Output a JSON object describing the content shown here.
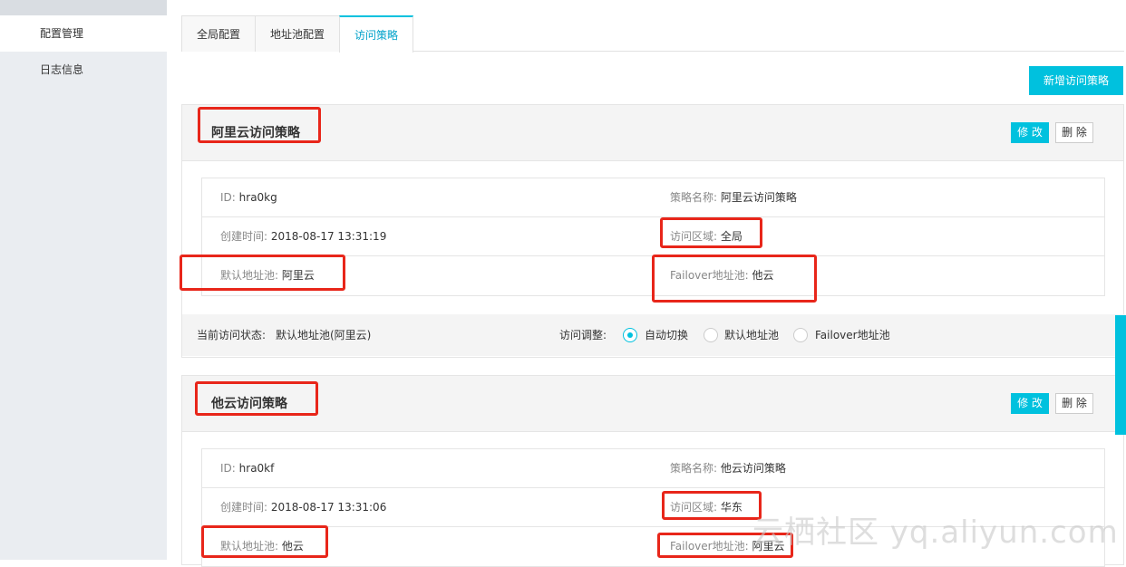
{
  "sidebar": {
    "items": [
      {
        "label": "配置管理"
      },
      {
        "label": "日志信息"
      }
    ]
  },
  "tabs": [
    {
      "label": "全局配置"
    },
    {
      "label": "地址池配置"
    },
    {
      "label": "访问策略"
    }
  ],
  "add_button": "新增访问策略",
  "edit_label": "修 改",
  "delete_label": "删 除",
  "policies": [
    {
      "title": "阿里云访问策略",
      "id_key": "ID:",
      "id_val": "hra0kg",
      "name_key": "策略名称:",
      "name_val": "阿里云访问策略",
      "created_key": "创建时间:",
      "created_val": "2018-08-17 13:31:19",
      "region_key": "访问区域:",
      "region_val": "全局",
      "default_key": "默认地址池:",
      "default_val": "阿里云",
      "failover_key": "Failover地址池:",
      "failover_val": "他云",
      "status_key": "当前访问状态:",
      "status_val": "默认地址池(阿里云)",
      "adjust_key": "访问调整:",
      "options": [
        "自动切换",
        "默认地址池",
        "Failover地址池"
      ]
    },
    {
      "title": "他云访问策略",
      "id_key": "ID:",
      "id_val": "hra0kf",
      "name_key": "策略名称:",
      "name_val": "他云访问策略",
      "created_key": "创建时间:",
      "created_val": "2018-08-17 13:31:06",
      "region_key": "访问区域:",
      "region_val": "华东",
      "default_key": "默认地址池:",
      "default_val": "他云",
      "failover_key": "Failover地址池:",
      "failover_val": "阿里云"
    }
  ],
  "watermark": "云栖社区 yq.aliyun.com",
  "colors": {
    "accent": "#00c1de",
    "highlight": "#e8261a"
  }
}
